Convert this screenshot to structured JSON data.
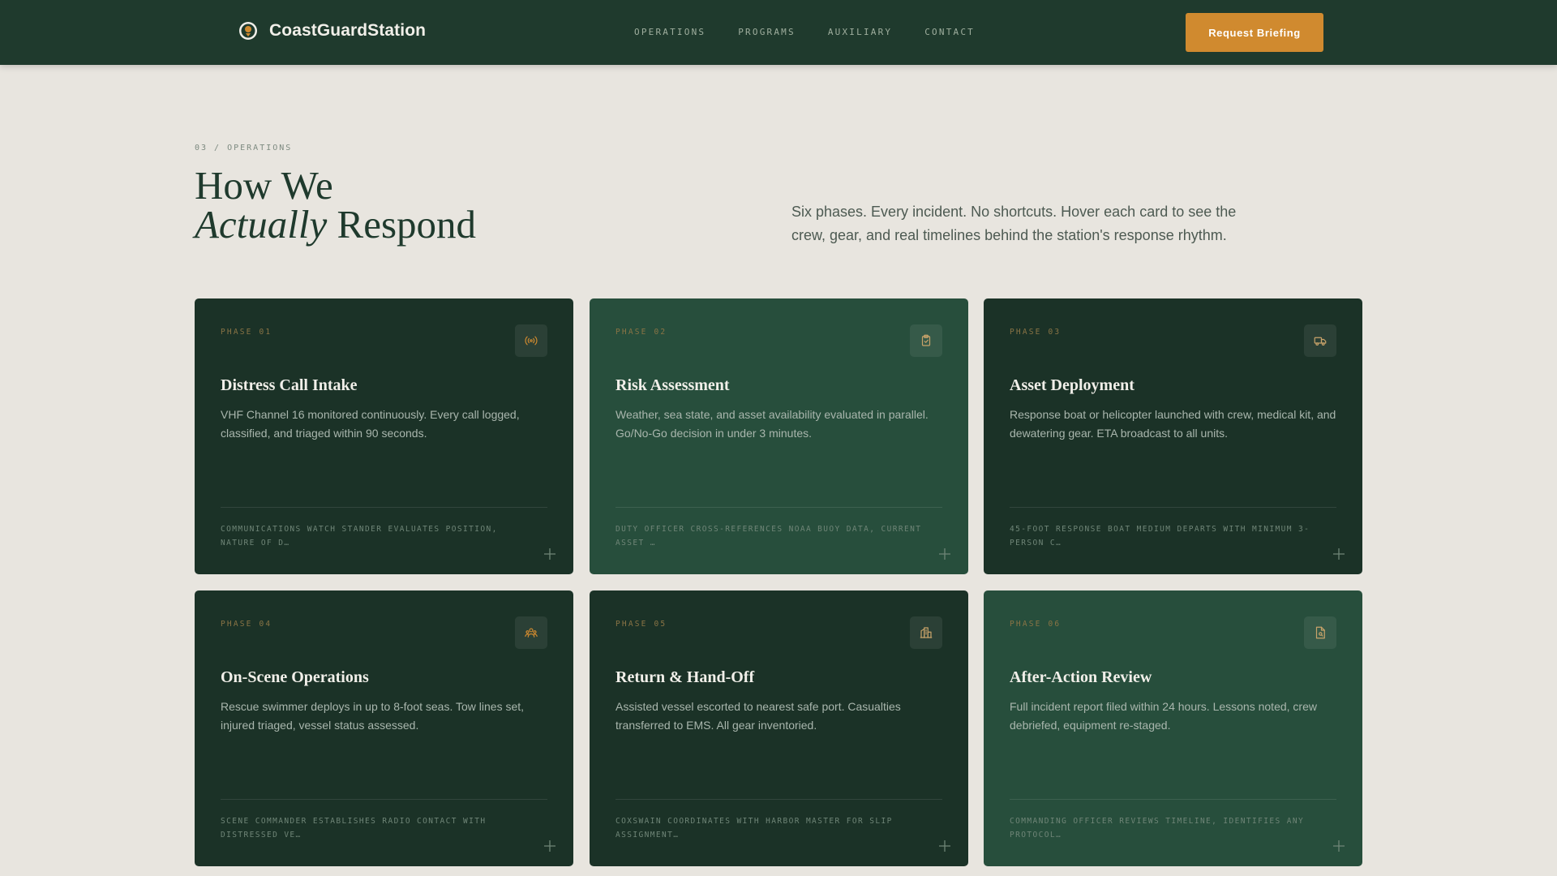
{
  "nav": {
    "brand_name": "CoastGuardStation",
    "links": [
      "OPERATIONS",
      "PROGRAMS",
      "AUXILIARY",
      "CONTACT"
    ],
    "cta_label": "Request Briefing"
  },
  "section": {
    "eyebrow": "03 / OPERATIONS",
    "heading_line1": "How We",
    "heading_italic": "Actually",
    "heading_line2_rest": " Respond",
    "intro": "Six phases. Every incident. No shortcuts. Hover each card to see the crew, gear, and real timelines behind the station's response rhythm."
  },
  "cards": [
    {
      "phase": "PHASE 01",
      "icon": "radio-signal-icon",
      "title": "Distress Call Intake",
      "description": "VHF Channel 16 monitored continuously. Every call logged, classified, and triaged within 90 seconds.",
      "detail": "COMMUNICATIONS WATCH STANDER EVALUATES POSITION, NATURE OF D…"
    },
    {
      "phase": "PHASE 02",
      "icon": "clipboard-check-icon",
      "title": "Risk Assessment",
      "description": "Weather, sea state, and asset availability evaluated in parallel. Go/No-Go decision in under 3 minutes.",
      "detail": "DUTY OFFICER CROSS-REFERENCES NOAA BUOY DATA, CURRENT ASSET …"
    },
    {
      "phase": "PHASE 03",
      "icon": "truck-icon",
      "title": "Asset Deployment",
      "description": "Response boat or helicopter launched with crew, medical kit, and dewatering gear. ETA broadcast to all units.",
      "detail": "45-FOOT RESPONSE BOAT MEDIUM DEPARTS WITH MINIMUM 3-PERSON C…"
    },
    {
      "phase": "PHASE 04",
      "icon": "crew-group-icon",
      "title": "On-Scene Operations",
      "description": "Rescue swimmer deploys in up to 8-foot seas. Tow lines set, injured triaged, vessel status assessed.",
      "detail": "SCENE COMMANDER ESTABLISHES RADIO CONTACT WITH DISTRESSED VE…"
    },
    {
      "phase": "PHASE 05",
      "icon": "harbor-building-icon",
      "title": "Return & Hand-Off",
      "description": "Assisted vessel escorted to nearest safe port. Casualties transferred to EMS. All gear inventoried.",
      "detail": "COXSWAIN COORDINATES WITH HARBOR MASTER FOR SLIP ASSIGNMENT…"
    },
    {
      "phase": "PHASE 06",
      "icon": "report-document-icon",
      "title": "After-Action Review",
      "description": "Full incident report filed within 24 hours. Lessons noted, crew debriefed, equipment re-staged.",
      "detail": "COMMANDING OFFICER REVIEWS TIMELINE, IDENTIFIES ANY PROTOCOL…"
    }
  ],
  "colors": {
    "nav_bg": "#1f3a2d",
    "page_bg": "#e8e5df",
    "accent": "#d08a2f",
    "card_dark": "#1b3227",
    "card_light": "#274e3c"
  }
}
